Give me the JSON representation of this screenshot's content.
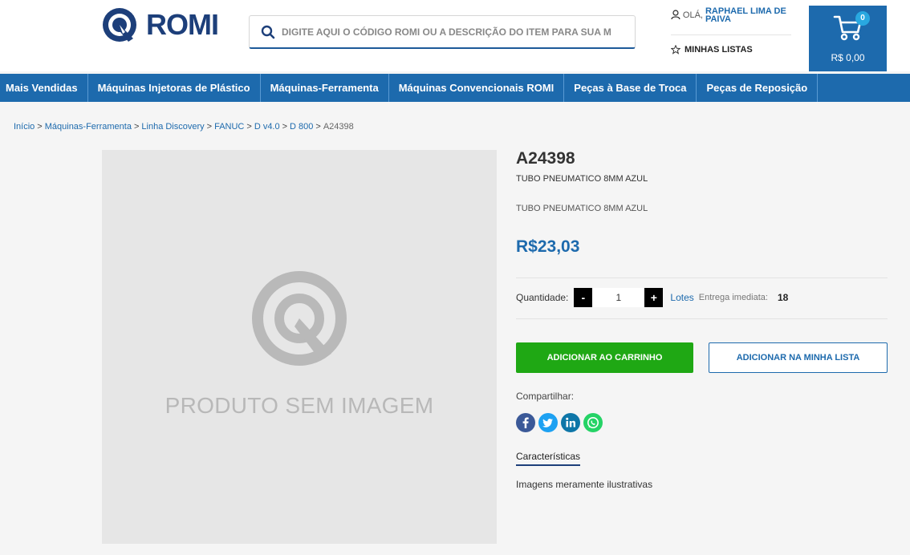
{
  "brand": {
    "name": "ROMI"
  },
  "search": {
    "placeholder": "DIGITE AQUI O CÓDIGO ROMI OU A DESCRIÇÃO DO ITEM PARA SUA M"
  },
  "user": {
    "greeting": "OLÁ,",
    "name": "RAPHAEL LIMA DE PAIVA"
  },
  "lists": {
    "label": "MINHAS LISTAS"
  },
  "cart": {
    "count": "0",
    "total": "R$ 0,00"
  },
  "nav": {
    "items": [
      {
        "label": "Mais Vendidas"
      },
      {
        "label": "Máquinas Injetoras de Plástico"
      },
      {
        "label": "Máquinas-Ferramenta"
      },
      {
        "label": "Máquinas Convencionais ROMI"
      },
      {
        "label": "Peças à Base de Troca"
      },
      {
        "label": "Peças de Reposição"
      }
    ]
  },
  "breadcrumb": {
    "items": [
      "Início",
      "Máquinas-Ferramenta",
      "Linha Discovery",
      "FANUC",
      "D v4.0",
      "D 800"
    ],
    "separator": ">",
    "current": "A24398"
  },
  "image": {
    "placeholder_text": "PRODUTO SEM IMAGEM"
  },
  "product": {
    "code": "A24398",
    "title": "TUBO PNEUMATICO 8MM AZUL",
    "description": "TUBO PNEUMATICO 8MM AZUL",
    "price": "R$23,03"
  },
  "quantity": {
    "label": "Quantidade:",
    "value": "1",
    "minus": "-",
    "plus": "+",
    "lotes": "Lotes",
    "delivery_label": "Entrega imediata:",
    "delivery_value": "18"
  },
  "actions": {
    "add_to_cart": "ADICIONAR AO CARRINHO",
    "add_to_list": "ADICIONAR NA MINHA LISTA"
  },
  "share": {
    "label": "Compartilhar:",
    "networks": [
      {
        "name": "facebook-icon",
        "color": "#3b5998",
        "glyph": "f"
      },
      {
        "name": "twitter-icon",
        "color": "#1da1f2",
        "glyph": ""
      },
      {
        "name": "linkedin-icon",
        "color": "#0e76a8",
        "glyph": "in"
      },
      {
        "name": "whatsapp-icon",
        "color": "#25d366",
        "glyph": ""
      }
    ]
  },
  "tabs": {
    "characteristics": "Características"
  },
  "note": "Imagens meramente ilustrativas",
  "colors": {
    "primary": "#1d6aad",
    "brand_dark": "#1d3f7a",
    "add_button": "#1fa814"
  }
}
